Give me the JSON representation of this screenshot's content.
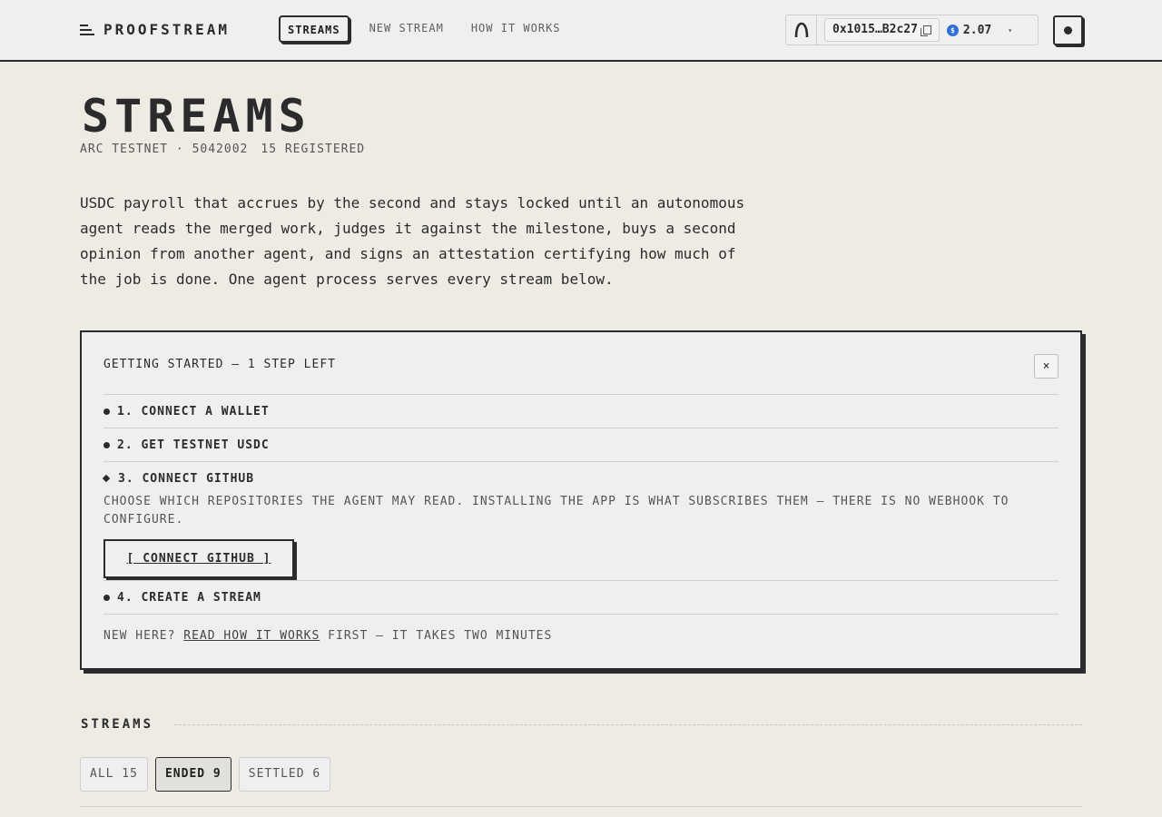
{
  "brand": {
    "name": "PROOFSTREAM",
    "icon": "stacked-lines-icon"
  },
  "nav": [
    {
      "label": "STREAMS",
      "active": true
    },
    {
      "label": "NEW STREAM",
      "active": false
    },
    {
      "label": "HOW IT WORKS",
      "active": false
    }
  ],
  "wallet": {
    "logo": "arc-logo-icon",
    "address": "0x1015…B2c27",
    "copy_icon": "copy-icon",
    "balance": "2.07",
    "token_icon": "usdc-icon",
    "menu_icon": "caret-down-icon"
  },
  "theme_toggle": {
    "icon": "circle-icon"
  },
  "page": {
    "title": "STREAMS",
    "network": "ARC TESTNET · 5042002",
    "registered": "15 REGISTERED",
    "intro": "USDC payroll that accrues by the second and stays locked until an autonomous agent reads the merged work, judges it against the milestone, buys a second opinion from another agent, and signs an attestation certifying how much of the job is done. One agent process serves every stream below."
  },
  "onboarding": {
    "heading": "GETTING STARTED — 1 STEP LEFT",
    "close_label": "×",
    "steps": [
      {
        "label": "1. CONNECT A WALLET",
        "state": "done"
      },
      {
        "label": "2. GET TESTNET USDC",
        "state": "done"
      },
      {
        "label": "3. CONNECT GITHUB",
        "state": "current",
        "description": "CHOOSE WHICH REPOSITORIES THE AGENT MAY READ. INSTALLING THE APP IS WHAT SUBSCRIBES THEM — THERE IS NO WEBHOOK TO CONFIGURE.",
        "button_label": "[ CONNECT GITHUB ]"
      },
      {
        "label": "4. CREATE A STREAM",
        "state": "done"
      }
    ],
    "footer_prefix": "NEW HERE?",
    "footer_link": "READ HOW IT WORKS",
    "footer_suffix": "FIRST — IT TAKES TWO MINUTES"
  },
  "streams_section": {
    "title": "STREAMS",
    "filters": [
      {
        "label": "ALL 15",
        "active": false
      },
      {
        "label": "ENDED 9",
        "active": true
      },
      {
        "label": "SETTLED 6",
        "active": false
      }
    ]
  },
  "colors": {
    "background": "#eeebe4",
    "panel": "#efefef",
    "ink": "#2b2b2b",
    "muted": "#555555",
    "usdc": "#2f6fd6"
  }
}
